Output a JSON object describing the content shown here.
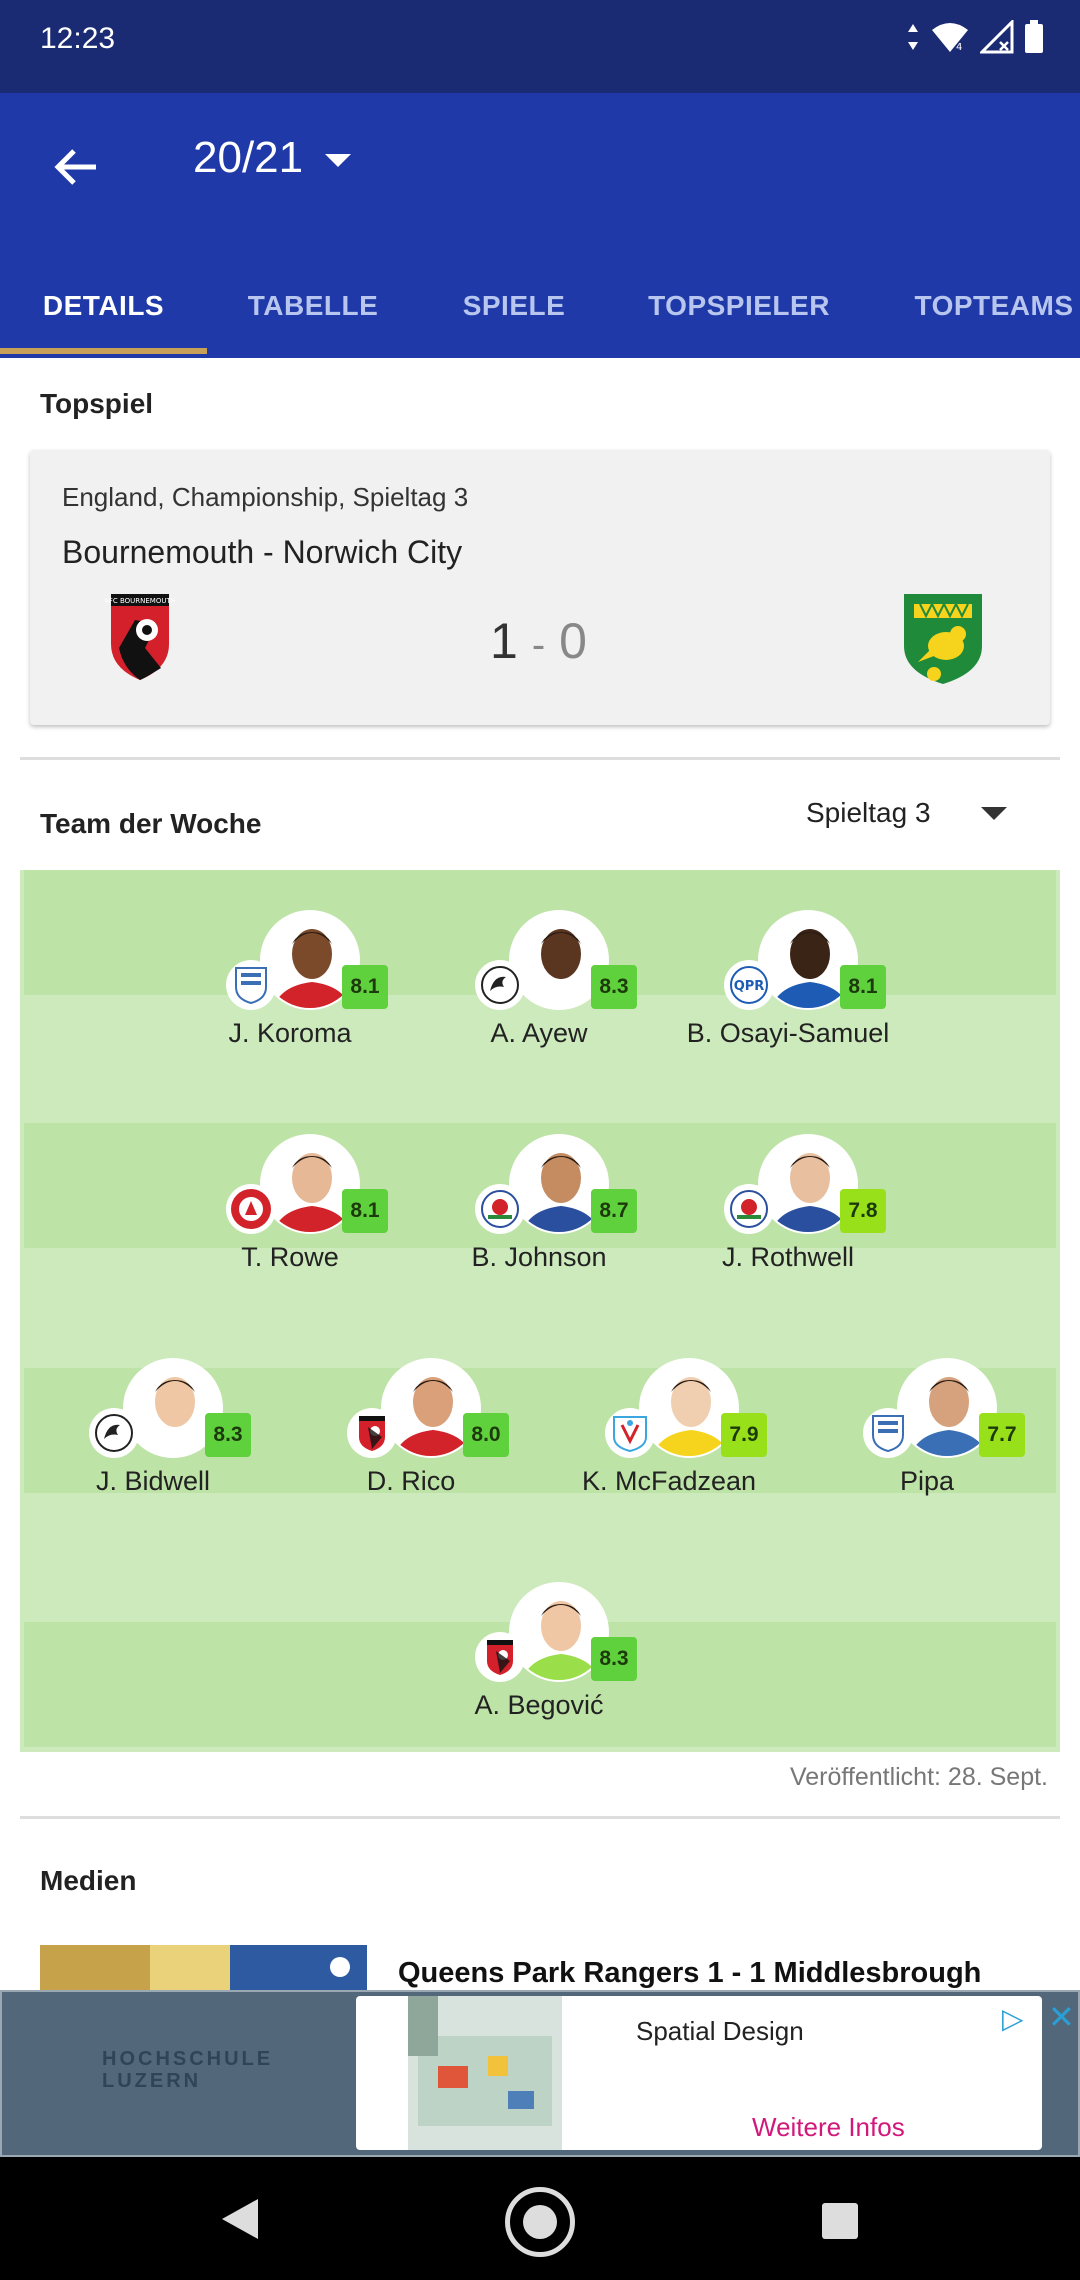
{
  "status": {
    "time": "12:23"
  },
  "header": {
    "season": "20/21"
  },
  "tabs": [
    "DETAILS",
    "TABELLE",
    "SPIELE",
    "TOPSPIELER",
    "TOPTEAMS"
  ],
  "top_game": {
    "section_title": "Topspiel",
    "competition": "England, Championship, Spieltag 3",
    "match": "Bournemouth - Norwich City",
    "home_score": "1",
    "separator": "-",
    "away_score": "0",
    "home_logo": "bournemouth-crest",
    "away_logo": "norwich-crest"
  },
  "team_of_week": {
    "title": "Team der Woche",
    "matchday": "Spieltag 3",
    "players": [
      {
        "name": "J. Koroma",
        "rating": "8.1",
        "club_icon": "huddersfield-crest"
      },
      {
        "name": "A. Ayew",
        "rating": "8.3",
        "club_icon": "swansea-crest"
      },
      {
        "name": "B. Osayi-Samuel",
        "rating": "8.1",
        "club_icon": "qpr-crest"
      },
      {
        "name": "T. Rowe",
        "rating": "8.1",
        "club_icon": "bristol-city-crest"
      },
      {
        "name": "B. Johnson",
        "rating": "8.7",
        "club_icon": "blackburn-crest"
      },
      {
        "name": "J. Rothwell",
        "rating": "7.8",
        "club_icon": "blackburn-crest"
      },
      {
        "name": "J. Bidwell",
        "rating": "8.3",
        "club_icon": "swansea-crest"
      },
      {
        "name": "D. Rico",
        "rating": "8.0",
        "club_icon": "bournemouth-crest"
      },
      {
        "name": "K. McFadzean",
        "rating": "7.9",
        "club_icon": "coventry-crest"
      },
      {
        "name": "Pipa",
        "rating": "7.7",
        "club_icon": "huddersfield-crest"
      },
      {
        "name": "A. Begović",
        "rating": "8.3",
        "club_icon": "bournemouth-crest"
      }
    ],
    "published": "Veröffentlicht: 28. Sept."
  },
  "media": {
    "section_title": "Medien",
    "item_title": "Queens Park Rangers 1 - 1 Middlesbrough"
  },
  "ad": {
    "brand_line1": "HOCHSCHULE",
    "brand_line2": "LUZERN",
    "headline": "Spatial Design",
    "cta": "Weitere Infos"
  },
  "colors": {
    "status_bar": "#1a2a73",
    "app_bar": "#1f3aa8",
    "tab_indicator": "#c7a15a",
    "pitch": "#cdeabc",
    "rating_high": "#5fd13c",
    "rating_mid": "#97e01a",
    "ad_cta": "#d1187b"
  }
}
